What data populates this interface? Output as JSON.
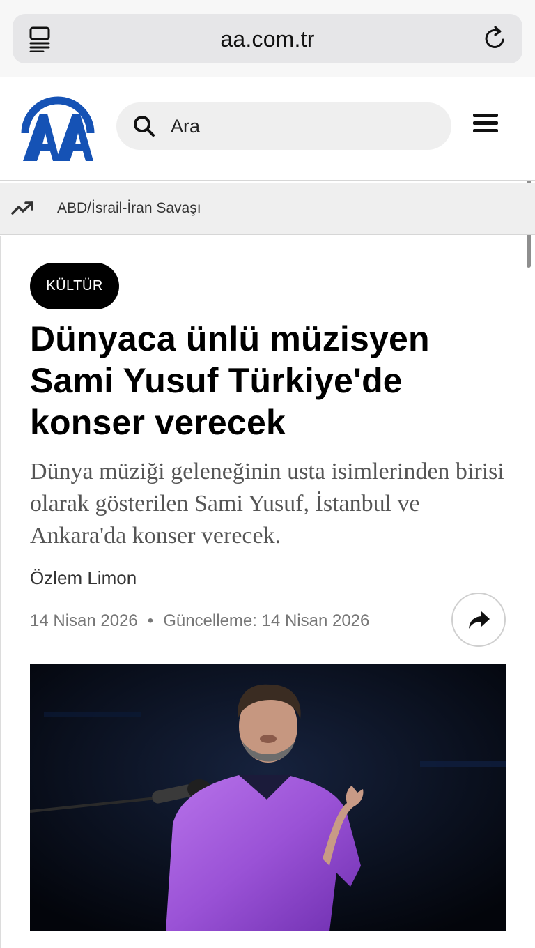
{
  "browser": {
    "url": "aa.com.tr",
    "tabs_icon": "tabs-overview-icon",
    "reload_icon": "reload-icon"
  },
  "header": {
    "logo_text": "AA",
    "search_placeholder": "Ara",
    "search_icon": "search-icon",
    "menu_icon": "hamburger-menu-icon"
  },
  "trending": {
    "icon": "trending-up-icon",
    "label": "ABD/İsrail-İran Savaşı"
  },
  "article": {
    "category": "KÜLTÜR",
    "headline": "Dünyaca ünlü müzisyen Sami Yusuf Türkiye'de konser verecek",
    "summary": "Dünya müziği geleneğinin usta isimlerinden birisi olarak gösterilen Sami Yusuf, İstanbul ve Ankara'da konser verecek.",
    "author": "Özlem Limon",
    "published_date": "14 Nisan 2026",
    "separator": "•",
    "updated_label": "Güncelleme: 14 Nisan 2026",
    "share_icon": "share-arrow-icon"
  },
  "colors": {
    "brand_blue": "#1552b5",
    "badge_bg": "#000000",
    "shirt_purple": "#9a52d6"
  }
}
